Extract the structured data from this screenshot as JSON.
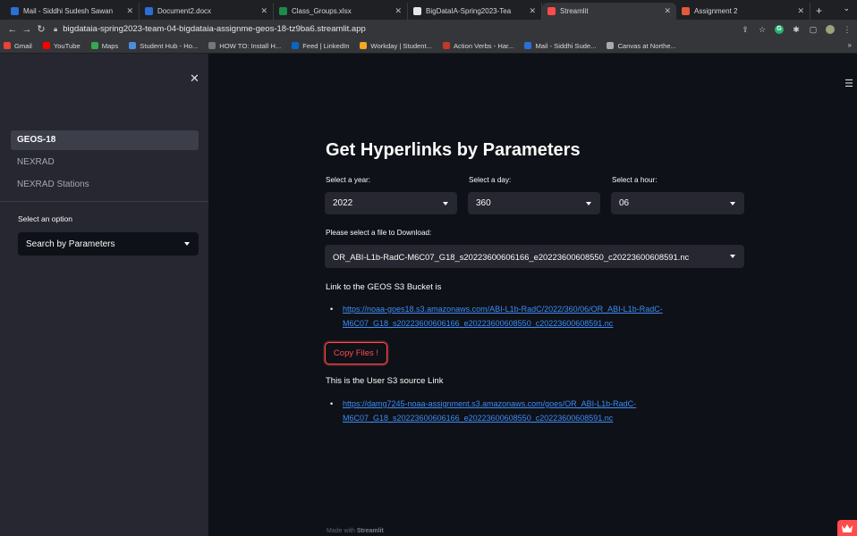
{
  "browser": {
    "tabs": [
      {
        "label": "Mail - Siddhi Sudesh Sawan",
        "color": "#2b6fd6"
      },
      {
        "label": "Document2.docx",
        "color": "#2b6fd6"
      },
      {
        "label": "Class_Groups.xlsx",
        "color": "#1f8a4c"
      },
      {
        "label": "BigDataIA-Spring2023-Tea",
        "color": "#e6e6e6"
      },
      {
        "label": "Streamlit",
        "color": "#ff4b4b"
      },
      {
        "label": "Assignment 2",
        "color": "#e25a3a"
      }
    ],
    "active_tab_index": 4,
    "url": "bigdataia-spring2023-team-04-bigdataia-assignme-geos-18-tz9ba6.streamlit.app",
    "bookmarks": [
      {
        "label": "Gmail",
        "color": "#ea4335"
      },
      {
        "label": "YouTube",
        "color": "#ff0000"
      },
      {
        "label": "Maps",
        "color": "#34a853"
      },
      {
        "label": "Student Hub - Ho...",
        "color": "#4a90d9"
      },
      {
        "label": "HOW TO: Install H...",
        "color": "#777777"
      },
      {
        "label": "Feed | LinkedIn",
        "color": "#0a66c2"
      },
      {
        "label": "Workday | Student...",
        "color": "#f5a623"
      },
      {
        "label": "Action Verbs - Har...",
        "color": "#c0392b"
      },
      {
        "label": "Mail - Siddhi Sude...",
        "color": "#2b6fd6"
      },
      {
        "label": "Canvas at Northe...",
        "color": "#aaaaaa"
      }
    ]
  },
  "sidebar": {
    "nav": [
      {
        "label": "GEOS-18",
        "selected": true
      },
      {
        "label": "NEXRAD",
        "selected": false
      },
      {
        "label": "NEXRAD Stations",
        "selected": false
      }
    ],
    "option_label": "Select an option",
    "option_value": "Search by Parameters"
  },
  "main": {
    "title": "Get Hyperlinks by Parameters",
    "year_label": "Select a year:",
    "year_value": "2022",
    "day_label": "Select a day:",
    "day_value": "360",
    "hour_label": "Select a hour:",
    "hour_value": "06",
    "file_label": "Please select a file to Download:",
    "file_value": "OR_ABI-L1b-RadC-M6C07_G18_s20223600606166_e20223600608550_c20223600608591.nc",
    "geos_link_label": "Link to the GEOS S3 Bucket is",
    "geos_link": "https://noaa-goes18.s3.amazonaws.com/ABI-L1b-RadC/2022/360/06/OR_ABI-L1b-RadC-M6C07_G18_s20223600606166_e20223600608550_c20223600608591.nc",
    "copy_button": "Copy Files !",
    "user_link_label": "This is the User S3 source Link",
    "user_link": "https://damg7245-noaa-assignment.s3.amazonaws.com/goes/OR_ABI-L1b-RadC-M6C07_G18_s20223600606166_e20223600608550_c20223600608591.nc",
    "footer_prefix": "Made with",
    "footer_brand": "Streamlit"
  },
  "colors": {
    "accent": "#ff4b4b",
    "link": "#3d8cf7",
    "sidebar_bg": "#262730",
    "main_bg": "#0e1117"
  },
  "icons": [
    "close-icon",
    "hamburger-menu-icon",
    "chevron-down-icon",
    "lock-icon",
    "back-icon",
    "forward-icon",
    "reload-icon",
    "share-icon",
    "star-icon",
    "extension-icon",
    "crown-icon"
  ]
}
